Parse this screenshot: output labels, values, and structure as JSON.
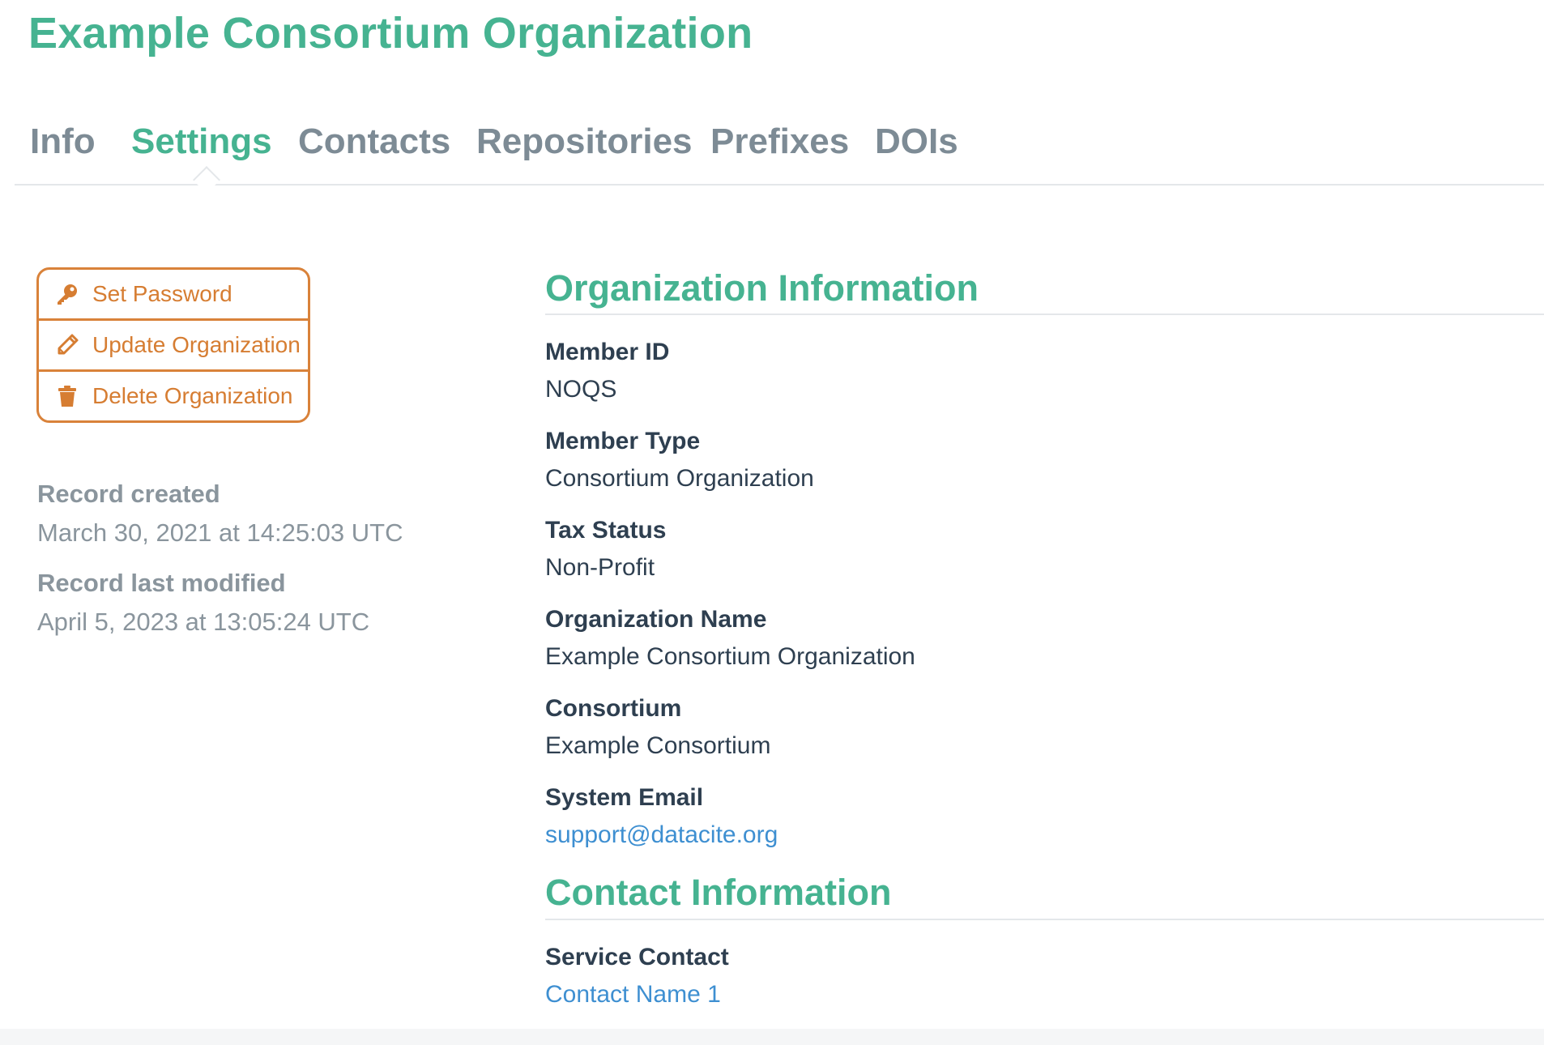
{
  "page": {
    "title": "Example Consortium Organization"
  },
  "tabs": [
    {
      "label": "Info",
      "active": false
    },
    {
      "label": "Settings",
      "active": true
    },
    {
      "label": "Contacts",
      "active": false
    },
    {
      "label": "Repositories",
      "active": false
    },
    {
      "label": "Prefixes",
      "active": false
    },
    {
      "label": "DOIs",
      "active": false
    }
  ],
  "actions": {
    "set_password": {
      "label": "Set Password",
      "icon": "key-icon"
    },
    "update_organization": {
      "label": "Update Organization",
      "icon": "pencil-icon"
    },
    "delete_organization": {
      "label": "Delete Organization",
      "icon": "trash-icon"
    }
  },
  "record": {
    "created_label": "Record created",
    "created_value": "March 30, 2021 at 14:25:03 UTC",
    "modified_label": "Record last modified",
    "modified_value": "April 5, 2023 at 13:05:24 UTC"
  },
  "organization_information": {
    "title": "Organization Information",
    "fields": [
      {
        "label": "Member ID",
        "value": "NOQS"
      },
      {
        "label": "Member Type",
        "value": "Consortium Organization"
      },
      {
        "label": "Tax Status",
        "value": "Non-Profit"
      },
      {
        "label": "Organization Name",
        "value": "Example Consortium Organization"
      },
      {
        "label": "Consortium",
        "value": "Example Consortium"
      },
      {
        "label": "System Email",
        "value": "support@datacite.org"
      }
    ]
  },
  "contact_information": {
    "title": "Contact Information",
    "fields": [
      {
        "label": "Service Contact",
        "value": "Contact Name 1"
      }
    ]
  },
  "colors": {
    "accent_green": "#46b391",
    "action_orange": "#d67d32",
    "link_blue": "#3e8fd1",
    "muted_gray": "#8a959d"
  }
}
